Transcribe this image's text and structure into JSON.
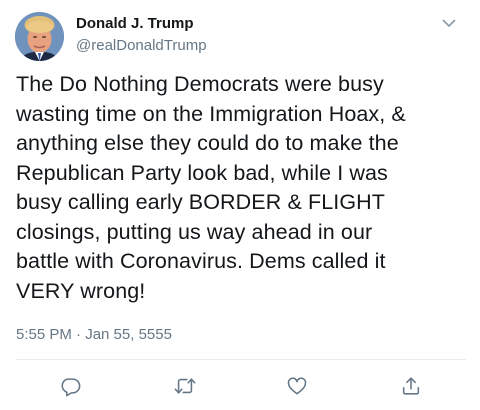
{
  "author": {
    "display_name": "Donald J. Trump",
    "handle": "@realDonaldTrump"
  },
  "tweet": {
    "text_lines": [
      "The Do Nothing Democrats were busy",
      "wasting time on the Immigration Hoax, &",
      "anything else they could do to make the",
      "Republican Party look bad, while I was",
      "busy calling early BORDER & FLIGHT",
      "closings, putting us way ahead in our",
      "battle with Coronavirus. Dems called it",
      "VERY wrong!"
    ],
    "timestamp": "5:55 PM · Jan 55, 5555"
  },
  "icons": {
    "menu": "chevron-down-icon",
    "reply": "reply-icon",
    "retweet": "retweet-icon",
    "like": "heart-icon",
    "share": "share-icon"
  },
  "colors": {
    "text": "#14171a",
    "secondary": "#657786",
    "icon": "#657786",
    "divider": "#e6ecf0"
  }
}
